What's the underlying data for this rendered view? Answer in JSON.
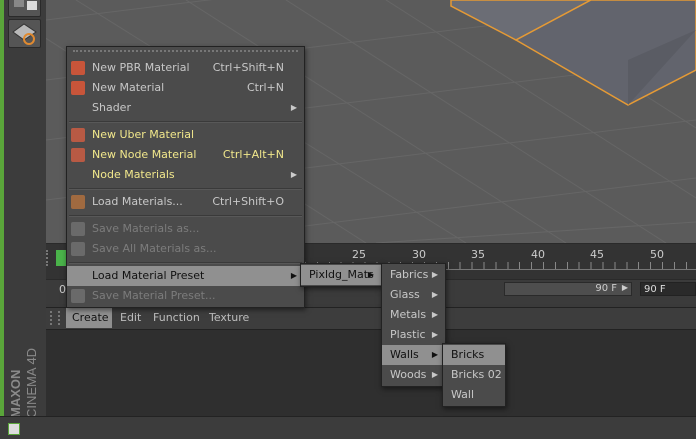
{
  "timeline": {
    "ticks": [
      "25",
      "30",
      "35",
      "40",
      "45",
      "50"
    ],
    "start_frame": "0",
    "end_field": "90 F",
    "end_field2": "90 F"
  },
  "material_manager": {
    "tabs": [
      "Create",
      "Edit",
      "Function",
      "Texture"
    ],
    "brand_top": "MAXON",
    "brand_bottom": "CINEMA 4D"
  },
  "create_menu": {
    "items": [
      {
        "label": "New PBR Material",
        "shortcut": "Ctrl+Shift+N",
        "icon": "material-icon"
      },
      {
        "label": "New Material",
        "shortcut": "Ctrl+N",
        "icon": "material-icon"
      },
      {
        "label": "Shader",
        "submenu": true
      },
      {
        "label": "New Uber Material",
        "icon": "uber-material-icon"
      },
      {
        "label": "New Node Material",
        "shortcut": "Ctrl+Alt+N",
        "icon": "node-material-icon"
      },
      {
        "label": "Node Materials",
        "submenu": true
      },
      {
        "label": "Load Materials...",
        "shortcut": "Ctrl+Shift+O",
        "icon": "load-icon"
      },
      {
        "label": "Save Materials as...",
        "icon": "save-icon"
      },
      {
        "label": "Save All Materials as...",
        "icon": "save-icon"
      },
      {
        "label": "Load Material Preset",
        "submenu": true
      },
      {
        "label": "Save Material Preset...",
        "icon": "save-icon"
      }
    ]
  },
  "preset_menu": {
    "label": "Pixldg_Mats"
  },
  "category_menu": {
    "items": [
      "Fabrics",
      "Glass",
      "Metals",
      "Plastic",
      "Walls",
      "Woods"
    ]
  },
  "walls_menu": {
    "items": [
      "Bricks",
      "Bricks 02",
      "Wall"
    ]
  },
  "colors": {
    "accent_orange": "#e59a35",
    "highlight": "#909090",
    "new_items": "#f2e88c"
  }
}
